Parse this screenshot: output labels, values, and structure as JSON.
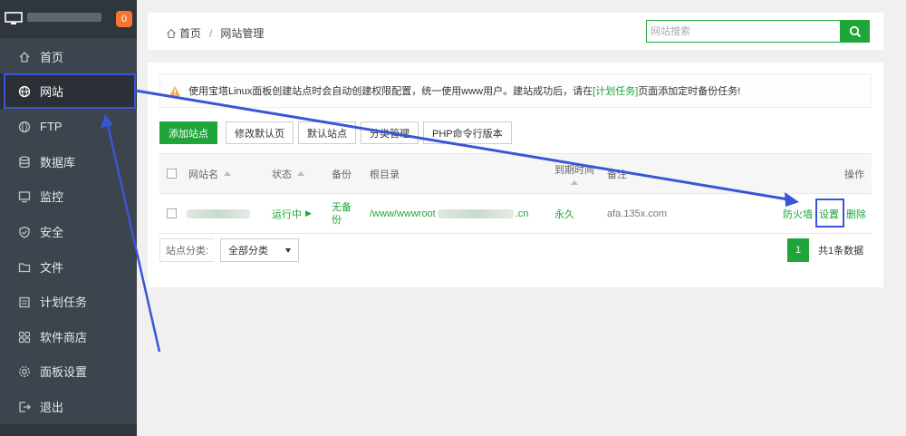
{
  "sidebar": {
    "notice_count": "0",
    "items": [
      {
        "label": "首页",
        "icon": "home-icon"
      },
      {
        "label": "网站",
        "icon": "globe-icon"
      },
      {
        "label": "FTP",
        "icon": "ftp-globe-icon"
      },
      {
        "label": "数据库",
        "icon": "database-icon"
      },
      {
        "label": "监控",
        "icon": "monitor-icon"
      },
      {
        "label": "安全",
        "icon": "shield-icon"
      },
      {
        "label": "文件",
        "icon": "folder-icon"
      },
      {
        "label": "计划任务",
        "icon": "calendar-icon"
      },
      {
        "label": "软件商店",
        "icon": "apps-icon"
      },
      {
        "label": "面板设置",
        "icon": "settings-icon"
      },
      {
        "label": "退出",
        "icon": "logout-icon"
      }
    ],
    "active_index": 1
  },
  "breadcrumb": {
    "home": "首页",
    "separator": "/",
    "current": "网站管理"
  },
  "search": {
    "placeholder": "网站搜索"
  },
  "alert": {
    "text_before": "使用宝塔Linux面板创建站点时会自动创建权限配置，统一使用www用户。建站成功后，请在",
    "link": "[计划任务]",
    "text_after": "页面添加定时备份任务!"
  },
  "toolbar": {
    "add_site": "添加站点",
    "modify_default_page": "修改默认页",
    "default_site": "默认站点",
    "category_manage": "分类管理",
    "php_cli_version": "PHP命令行版本"
  },
  "table": {
    "headers": {
      "name": "网站名",
      "status": "状态",
      "backup": "备份",
      "root": "根目录",
      "expire": "到期时间",
      "remark": "备注",
      "actions": "操作"
    },
    "rows": [
      {
        "status": "运行中",
        "backup": "无备份",
        "root_prefix": "/www/wwwroot",
        "root_suffix": ".cn",
        "expire": "永久",
        "remark": "afa.135x.com",
        "firewall": "防火墙",
        "settings": "设置",
        "delete": "删除"
      }
    ]
  },
  "footer": {
    "category_label": "站点分类:",
    "category_value": "全部分类",
    "page": "1",
    "total": "共1条数据"
  },
  "colors": {
    "accent": "#20a53a",
    "annotation": "#3a56d4",
    "sidebar": "#3c444d"
  }
}
